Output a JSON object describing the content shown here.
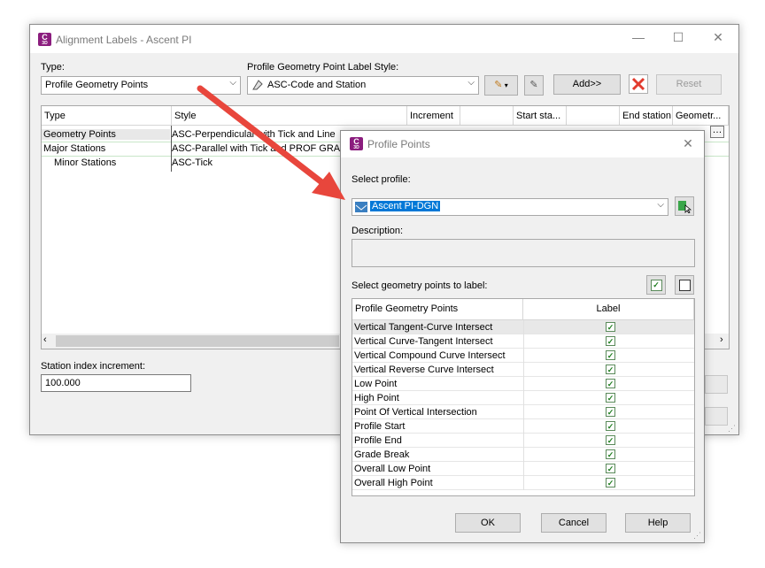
{
  "main_dialog": {
    "title": "Alignment Labels - Ascent PI",
    "type_label": "Type:",
    "type_value": "Profile Geometry Points",
    "style_label": "Profile Geometry Point Label Style:",
    "style_value": "ASC-Code and Station",
    "add_label": "Add>>",
    "reset_label": "Reset",
    "columns": [
      "Type",
      "Style",
      "Increment",
      "Start sta...",
      "End station",
      "Geometr..."
    ],
    "rows": [
      {
        "type": "Geometry Points",
        "style": "ASC-Perpendicular with Tick and Line"
      },
      {
        "type": "Major Stations",
        "style": "ASC-Parallel with Tick and PROF GRADE"
      },
      {
        "type": "Minor Stations",
        "style": "ASC-Tick"
      }
    ],
    "station_index_label": "Station index increment:",
    "station_index_value": "100.000"
  },
  "profile_dialog": {
    "title": "Profile Points",
    "select_profile_label": "Select profile:",
    "profile_value": "Ascent PI-DGN",
    "description_label": "Description:",
    "select_points_label": "Select geometry points to label:",
    "col_points": "Profile Geometry Points",
    "col_label": "Label",
    "points": [
      "Vertical Tangent-Curve Intersect",
      "Vertical Curve-Tangent Intersect",
      "Vertical Compound Curve Intersect",
      "Vertical Reverse Curve Intersect",
      "Low Point",
      "High Point",
      "Point Of Vertical Intersection",
      "Profile Start",
      "Profile End",
      "Grade Break",
      "Overall Low Point",
      "Overall High Point"
    ],
    "ok_label": "OK",
    "cancel_label": "Cancel",
    "help_label": "Help"
  },
  "colors": {
    "arrow": "#e8463c",
    "selection": "#0078d7",
    "app_icon": "#8b1d7e"
  }
}
